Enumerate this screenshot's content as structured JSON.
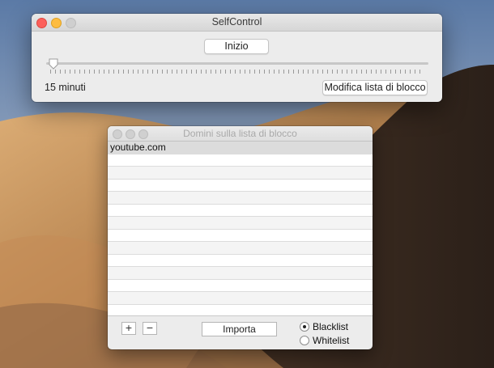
{
  "main_window": {
    "title": "SelfControl",
    "start_button": "Inizio",
    "duration_label": "15 minuti",
    "duration_slider_position": 0,
    "modify_button": "Modifica lista di blocco"
  },
  "list_window": {
    "title": "Domini sulla lista di blocco",
    "domains": [
      "youtube.com",
      "",
      "",
      "",
      "",
      "",
      "",
      "",
      "",
      "",
      "",
      "",
      ""
    ],
    "add_button": "+",
    "remove_button": "−",
    "import_button": "Importa",
    "radio_blacklist": "Blacklist",
    "radio_whitelist": "Whitelist",
    "selected_mode": "Blacklist"
  },
  "colors": {
    "close": "#fc605b",
    "minimize": "#fdbc40",
    "window_bg": "#ececec"
  }
}
